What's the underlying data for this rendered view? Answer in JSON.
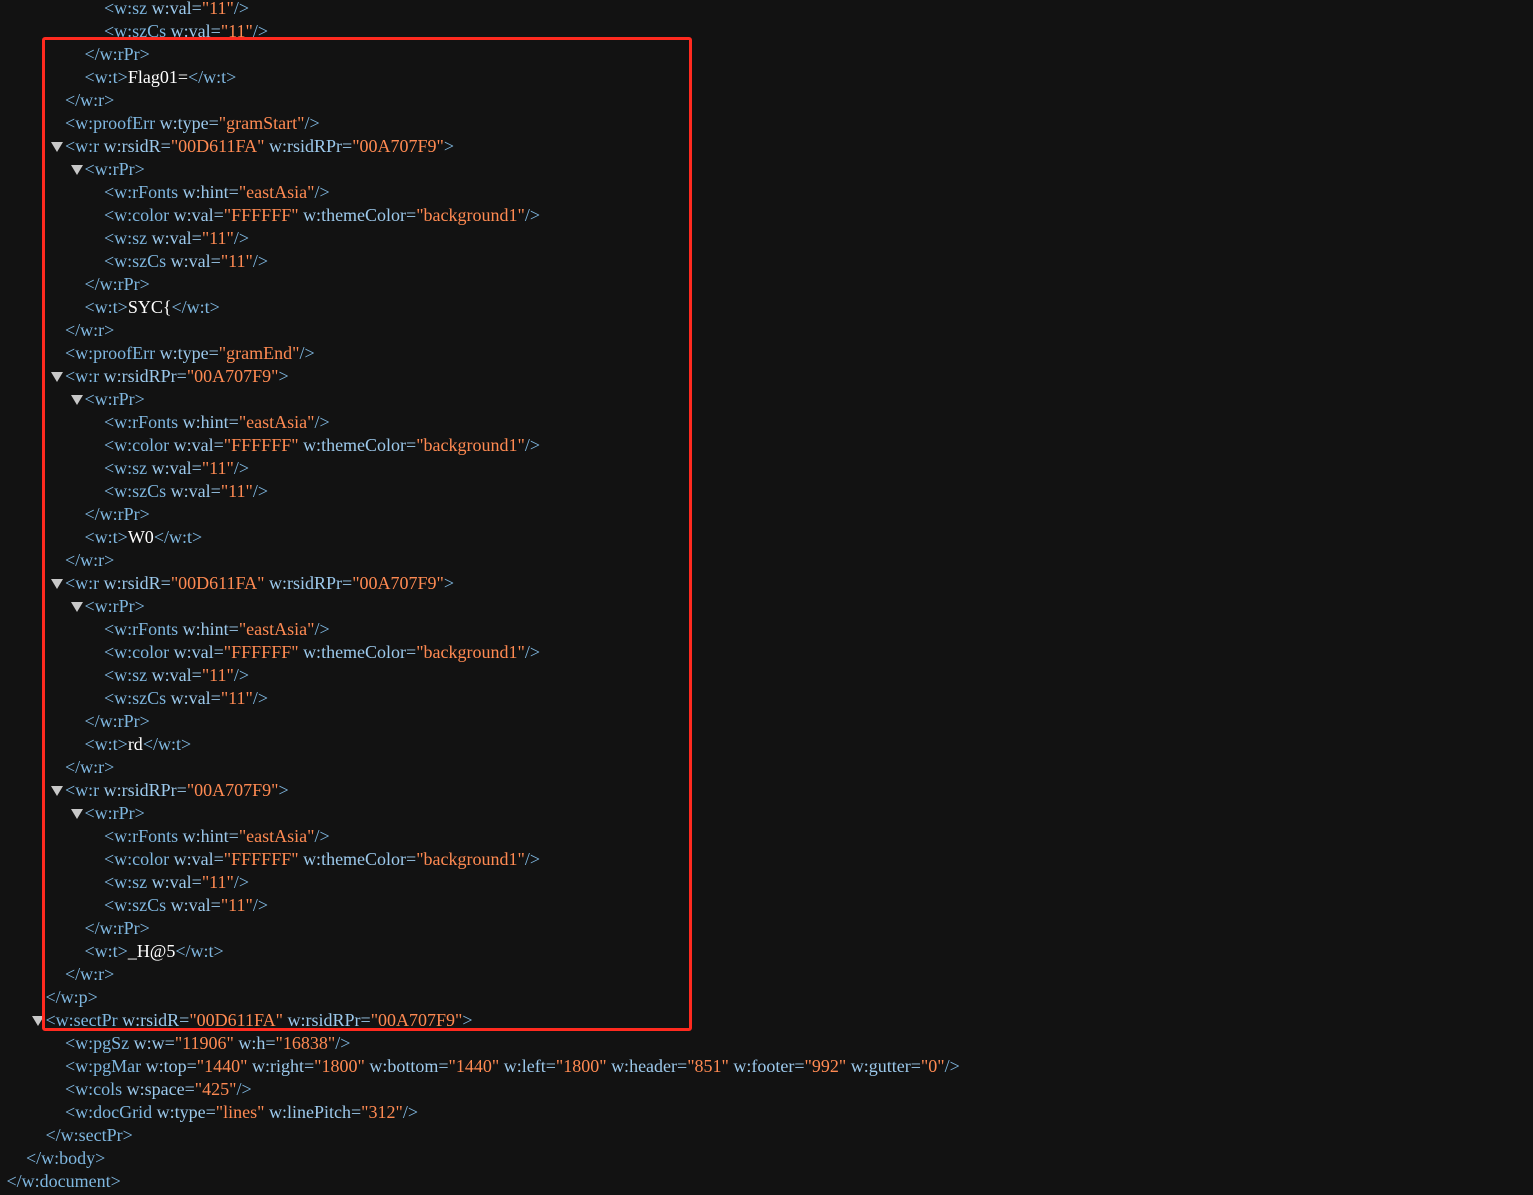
{
  "xml_tree": {
    "lines": [
      {
        "indent": 4,
        "toggle": false,
        "tokens": [
          {
            "t": "tag",
            "s": "<w:sz "
          },
          {
            "t": "attr",
            "s": "w:val="
          },
          {
            "t": "val",
            "s": "\"11\""
          },
          {
            "t": "tag",
            "s": "/>"
          }
        ]
      },
      {
        "indent": 4,
        "toggle": false,
        "tokens": [
          {
            "t": "tag",
            "s": "<w:szCs "
          },
          {
            "t": "attr",
            "s": "w:val="
          },
          {
            "t": "val",
            "s": "\"11\""
          },
          {
            "t": "tag",
            "s": "/>"
          }
        ]
      },
      {
        "indent": 3,
        "toggle": false,
        "tokens": [
          {
            "t": "tag",
            "s": "</w:rPr>"
          }
        ]
      },
      {
        "indent": 3,
        "toggle": false,
        "tokens": [
          {
            "t": "tag",
            "s": "<w:t>"
          },
          {
            "t": "txt",
            "s": "Flag01="
          },
          {
            "t": "tag",
            "s": "</w:t>"
          }
        ]
      },
      {
        "indent": 2,
        "toggle": false,
        "tokens": [
          {
            "t": "tag",
            "s": "</w:r>"
          }
        ]
      },
      {
        "indent": 2,
        "toggle": false,
        "tokens": [
          {
            "t": "tag",
            "s": "<w:proofErr "
          },
          {
            "t": "attr",
            "s": "w:type="
          },
          {
            "t": "val",
            "s": "\"gramStart\""
          },
          {
            "t": "tag",
            "s": "/>"
          }
        ]
      },
      {
        "indent": 2,
        "toggle": true,
        "tokens": [
          {
            "t": "tag",
            "s": "<w:r "
          },
          {
            "t": "attr",
            "s": "w:rsidR="
          },
          {
            "t": "val",
            "s": "\"00D611FA\""
          },
          {
            "t": "attr",
            "s": " w:rsidRPr="
          },
          {
            "t": "val",
            "s": "\"00A707F9\""
          },
          {
            "t": "tag",
            "s": ">"
          }
        ]
      },
      {
        "indent": 3,
        "toggle": true,
        "tokens": [
          {
            "t": "tag",
            "s": "<w:rPr>"
          }
        ]
      },
      {
        "indent": 4,
        "toggle": false,
        "tokens": [
          {
            "t": "tag",
            "s": "<w:rFonts "
          },
          {
            "t": "attr",
            "s": "w:hint="
          },
          {
            "t": "val",
            "s": "\"eastAsia\""
          },
          {
            "t": "tag",
            "s": "/>"
          }
        ]
      },
      {
        "indent": 4,
        "toggle": false,
        "tokens": [
          {
            "t": "tag",
            "s": "<w:color "
          },
          {
            "t": "attr",
            "s": "w:val="
          },
          {
            "t": "val",
            "s": "\"FFFFFF\""
          },
          {
            "t": "attr",
            "s": " w:themeColor="
          },
          {
            "t": "val",
            "s": "\"background1\""
          },
          {
            "t": "tag",
            "s": "/>"
          }
        ]
      },
      {
        "indent": 4,
        "toggle": false,
        "tokens": [
          {
            "t": "tag",
            "s": "<w:sz "
          },
          {
            "t": "attr",
            "s": "w:val="
          },
          {
            "t": "val",
            "s": "\"11\""
          },
          {
            "t": "tag",
            "s": "/>"
          }
        ]
      },
      {
        "indent": 4,
        "toggle": false,
        "tokens": [
          {
            "t": "tag",
            "s": "<w:szCs "
          },
          {
            "t": "attr",
            "s": "w:val="
          },
          {
            "t": "val",
            "s": "\"11\""
          },
          {
            "t": "tag",
            "s": "/>"
          }
        ]
      },
      {
        "indent": 3,
        "toggle": false,
        "tokens": [
          {
            "t": "tag",
            "s": "</w:rPr>"
          }
        ]
      },
      {
        "indent": 3,
        "toggle": false,
        "tokens": [
          {
            "t": "tag",
            "s": "<w:t>"
          },
          {
            "t": "txt",
            "s": "SYC{"
          },
          {
            "t": "tag",
            "s": "</w:t>"
          }
        ]
      },
      {
        "indent": 2,
        "toggle": false,
        "tokens": [
          {
            "t": "tag",
            "s": "</w:r>"
          }
        ]
      },
      {
        "indent": 2,
        "toggle": false,
        "tokens": [
          {
            "t": "tag",
            "s": "<w:proofErr "
          },
          {
            "t": "attr",
            "s": "w:type="
          },
          {
            "t": "val",
            "s": "\"gramEnd\""
          },
          {
            "t": "tag",
            "s": "/>"
          }
        ]
      },
      {
        "indent": 2,
        "toggle": true,
        "tokens": [
          {
            "t": "tag",
            "s": "<w:r "
          },
          {
            "t": "attr",
            "s": "w:rsidRPr="
          },
          {
            "t": "val",
            "s": "\"00A707F9\""
          },
          {
            "t": "tag",
            "s": ">"
          }
        ]
      },
      {
        "indent": 3,
        "toggle": true,
        "tokens": [
          {
            "t": "tag",
            "s": "<w:rPr>"
          }
        ]
      },
      {
        "indent": 4,
        "toggle": false,
        "tokens": [
          {
            "t": "tag",
            "s": "<w:rFonts "
          },
          {
            "t": "attr",
            "s": "w:hint="
          },
          {
            "t": "val",
            "s": "\"eastAsia\""
          },
          {
            "t": "tag",
            "s": "/>"
          }
        ]
      },
      {
        "indent": 4,
        "toggle": false,
        "tokens": [
          {
            "t": "tag",
            "s": "<w:color "
          },
          {
            "t": "attr",
            "s": "w:val="
          },
          {
            "t": "val",
            "s": "\"FFFFFF\""
          },
          {
            "t": "attr",
            "s": " w:themeColor="
          },
          {
            "t": "val",
            "s": "\"background1\""
          },
          {
            "t": "tag",
            "s": "/>"
          }
        ]
      },
      {
        "indent": 4,
        "toggle": false,
        "tokens": [
          {
            "t": "tag",
            "s": "<w:sz "
          },
          {
            "t": "attr",
            "s": "w:val="
          },
          {
            "t": "val",
            "s": "\"11\""
          },
          {
            "t": "tag",
            "s": "/>"
          }
        ]
      },
      {
        "indent": 4,
        "toggle": false,
        "tokens": [
          {
            "t": "tag",
            "s": "<w:szCs "
          },
          {
            "t": "attr",
            "s": "w:val="
          },
          {
            "t": "val",
            "s": "\"11\""
          },
          {
            "t": "tag",
            "s": "/>"
          }
        ]
      },
      {
        "indent": 3,
        "toggle": false,
        "tokens": [
          {
            "t": "tag",
            "s": "</w:rPr>"
          }
        ]
      },
      {
        "indent": 3,
        "toggle": false,
        "tokens": [
          {
            "t": "tag",
            "s": "<w:t>"
          },
          {
            "t": "txt",
            "s": "W0"
          },
          {
            "t": "tag",
            "s": "</w:t>"
          }
        ]
      },
      {
        "indent": 2,
        "toggle": false,
        "tokens": [
          {
            "t": "tag",
            "s": "</w:r>"
          }
        ]
      },
      {
        "indent": 2,
        "toggle": true,
        "tokens": [
          {
            "t": "tag",
            "s": "<w:r "
          },
          {
            "t": "attr",
            "s": "w:rsidR="
          },
          {
            "t": "val",
            "s": "\"00D611FA\""
          },
          {
            "t": "attr",
            "s": " w:rsidRPr="
          },
          {
            "t": "val",
            "s": "\"00A707F9\""
          },
          {
            "t": "tag",
            "s": ">"
          }
        ]
      },
      {
        "indent": 3,
        "toggle": true,
        "tokens": [
          {
            "t": "tag",
            "s": "<w:rPr>"
          }
        ]
      },
      {
        "indent": 4,
        "toggle": false,
        "tokens": [
          {
            "t": "tag",
            "s": "<w:rFonts "
          },
          {
            "t": "attr",
            "s": "w:hint="
          },
          {
            "t": "val",
            "s": "\"eastAsia\""
          },
          {
            "t": "tag",
            "s": "/>"
          }
        ]
      },
      {
        "indent": 4,
        "toggle": false,
        "tokens": [
          {
            "t": "tag",
            "s": "<w:color "
          },
          {
            "t": "attr",
            "s": "w:val="
          },
          {
            "t": "val",
            "s": "\"FFFFFF\""
          },
          {
            "t": "attr",
            "s": " w:themeColor="
          },
          {
            "t": "val",
            "s": "\"background1\""
          },
          {
            "t": "tag",
            "s": "/>"
          }
        ]
      },
      {
        "indent": 4,
        "toggle": false,
        "tokens": [
          {
            "t": "tag",
            "s": "<w:sz "
          },
          {
            "t": "attr",
            "s": "w:val="
          },
          {
            "t": "val",
            "s": "\"11\""
          },
          {
            "t": "tag",
            "s": "/>"
          }
        ]
      },
      {
        "indent": 4,
        "toggle": false,
        "tokens": [
          {
            "t": "tag",
            "s": "<w:szCs "
          },
          {
            "t": "attr",
            "s": "w:val="
          },
          {
            "t": "val",
            "s": "\"11\""
          },
          {
            "t": "tag",
            "s": "/>"
          }
        ]
      },
      {
        "indent": 3,
        "toggle": false,
        "tokens": [
          {
            "t": "tag",
            "s": "</w:rPr>"
          }
        ]
      },
      {
        "indent": 3,
        "toggle": false,
        "tokens": [
          {
            "t": "tag",
            "s": "<w:t>"
          },
          {
            "t": "txt",
            "s": "rd"
          },
          {
            "t": "tag",
            "s": "</w:t>"
          }
        ]
      },
      {
        "indent": 2,
        "toggle": false,
        "tokens": [
          {
            "t": "tag",
            "s": "</w:r>"
          }
        ]
      },
      {
        "indent": 2,
        "toggle": true,
        "tokens": [
          {
            "t": "tag",
            "s": "<w:r "
          },
          {
            "t": "attr",
            "s": "w:rsidRPr="
          },
          {
            "t": "val",
            "s": "\"00A707F9\""
          },
          {
            "t": "tag",
            "s": ">"
          }
        ]
      },
      {
        "indent": 3,
        "toggle": true,
        "tokens": [
          {
            "t": "tag",
            "s": "<w:rPr>"
          }
        ]
      },
      {
        "indent": 4,
        "toggle": false,
        "tokens": [
          {
            "t": "tag",
            "s": "<w:rFonts "
          },
          {
            "t": "attr",
            "s": "w:hint="
          },
          {
            "t": "val",
            "s": "\"eastAsia\""
          },
          {
            "t": "tag",
            "s": "/>"
          }
        ]
      },
      {
        "indent": 4,
        "toggle": false,
        "tokens": [
          {
            "t": "tag",
            "s": "<w:color "
          },
          {
            "t": "attr",
            "s": "w:val="
          },
          {
            "t": "val",
            "s": "\"FFFFFF\""
          },
          {
            "t": "attr",
            "s": " w:themeColor="
          },
          {
            "t": "val",
            "s": "\"background1\""
          },
          {
            "t": "tag",
            "s": "/>"
          }
        ]
      },
      {
        "indent": 4,
        "toggle": false,
        "tokens": [
          {
            "t": "tag",
            "s": "<w:sz "
          },
          {
            "t": "attr",
            "s": "w:val="
          },
          {
            "t": "val",
            "s": "\"11\""
          },
          {
            "t": "tag",
            "s": "/>"
          }
        ]
      },
      {
        "indent": 4,
        "toggle": false,
        "tokens": [
          {
            "t": "tag",
            "s": "<w:szCs "
          },
          {
            "t": "attr",
            "s": "w:val="
          },
          {
            "t": "val",
            "s": "\"11\""
          },
          {
            "t": "tag",
            "s": "/>"
          }
        ]
      },
      {
        "indent": 3,
        "toggle": false,
        "tokens": [
          {
            "t": "tag",
            "s": "</w:rPr>"
          }
        ]
      },
      {
        "indent": 3,
        "toggle": false,
        "tokens": [
          {
            "t": "tag",
            "s": "<w:t>"
          },
          {
            "t": "txt",
            "s": "_H@5"
          },
          {
            "t": "tag",
            "s": "</w:t>"
          }
        ]
      },
      {
        "indent": 2,
        "toggle": false,
        "tokens": [
          {
            "t": "tag",
            "s": "</w:r>"
          }
        ]
      },
      {
        "indent": 1,
        "toggle": false,
        "tokens": [
          {
            "t": "tag",
            "s": "</w:p>"
          }
        ]
      },
      {
        "indent": 1,
        "toggle": true,
        "tokens": [
          {
            "t": "tag",
            "s": "<w:sectPr "
          },
          {
            "t": "attr",
            "s": "w:rsidR="
          },
          {
            "t": "val",
            "s": "\"00D611FA\""
          },
          {
            "t": "attr",
            "s": " w:rsidRPr="
          },
          {
            "t": "val",
            "s": "\"00A707F9\""
          },
          {
            "t": "tag",
            "s": ">"
          }
        ]
      },
      {
        "indent": 2,
        "toggle": false,
        "tokens": [
          {
            "t": "tag",
            "s": "<w:pgSz "
          },
          {
            "t": "attr",
            "s": "w:w="
          },
          {
            "t": "val",
            "s": "\"11906\""
          },
          {
            "t": "attr",
            "s": " w:h="
          },
          {
            "t": "val",
            "s": "\"16838\""
          },
          {
            "t": "tag",
            "s": "/>"
          }
        ]
      },
      {
        "indent": 2,
        "toggle": false,
        "tokens": [
          {
            "t": "tag",
            "s": "<w:pgMar "
          },
          {
            "t": "attr",
            "s": "w:top="
          },
          {
            "t": "val",
            "s": "\"1440\""
          },
          {
            "t": "attr",
            "s": " w:right="
          },
          {
            "t": "val",
            "s": "\"1800\""
          },
          {
            "t": "attr",
            "s": " w:bottom="
          },
          {
            "t": "val",
            "s": "\"1440\""
          },
          {
            "t": "attr",
            "s": " w:left="
          },
          {
            "t": "val",
            "s": "\"1800\""
          },
          {
            "t": "attr",
            "s": " w:header="
          },
          {
            "t": "val",
            "s": "\"851\""
          },
          {
            "t": "attr",
            "s": " w:footer="
          },
          {
            "t": "val",
            "s": "\"992\""
          },
          {
            "t": "attr",
            "s": " w:gutter="
          },
          {
            "t": "val",
            "s": "\"0\""
          },
          {
            "t": "tag",
            "s": "/>"
          }
        ]
      },
      {
        "indent": 2,
        "toggle": false,
        "tokens": [
          {
            "t": "tag",
            "s": "<w:cols "
          },
          {
            "t": "attr",
            "s": "w:space="
          },
          {
            "t": "val",
            "s": "\"425\""
          },
          {
            "t": "tag",
            "s": "/>"
          }
        ]
      },
      {
        "indent": 2,
        "toggle": false,
        "tokens": [
          {
            "t": "tag",
            "s": "<w:docGrid "
          },
          {
            "t": "attr",
            "s": "w:type="
          },
          {
            "t": "val",
            "s": "\"lines\""
          },
          {
            "t": "attr",
            "s": " w:linePitch="
          },
          {
            "t": "val",
            "s": "\"312\""
          },
          {
            "t": "tag",
            "s": "/>"
          }
        ]
      },
      {
        "indent": 1,
        "toggle": false,
        "tokens": [
          {
            "t": "tag",
            "s": "</w:sectPr>"
          }
        ]
      },
      {
        "indent": 0,
        "toggle": false,
        "tokens": [
          {
            "t": "tag",
            "s": "</w:body>"
          }
        ]
      },
      {
        "indent": -1,
        "toggle": false,
        "tokens": [
          {
            "t": "tag",
            "s": "</w:document>"
          }
        ]
      }
    ]
  },
  "colors": {
    "background": "#121212",
    "tag": "#7fb7e0",
    "attribute": "#9cc9ec",
    "value": "#ff8a52",
    "text": "#ffffff",
    "highlight_border": "#ff2a1f"
  },
  "icons": {
    "toggle": "triangle-down-icon"
  }
}
